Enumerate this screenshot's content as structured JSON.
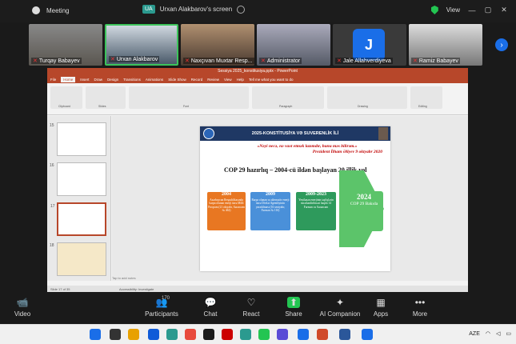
{
  "titlebar": {
    "app_name": "Meeting",
    "share_badge": "UA",
    "share_title": "Urxan Alakbarov's screen",
    "view_label": "View",
    "min_glyph": "—",
    "max_glyph": "▢",
    "close_glyph": "✕"
  },
  "gallery": {
    "participants": [
      {
        "name": "Turqay Babayev",
        "muted": true,
        "bg": "#6d6a63"
      },
      {
        "name": "Urxan Alakbarov",
        "muted": true,
        "bg": "#4a5a6a",
        "active": true
      },
      {
        "name": "Naxçıvan Muxtar Resp...",
        "muted": true,
        "bg": "#5c4a3e"
      },
      {
        "name": "Administrator",
        "muted": true,
        "bg": "#6c6f78"
      },
      {
        "name": "Jale Allahverdiyeva",
        "muted": true,
        "avatar": "J"
      },
      {
        "name": "Ramiz Babayev",
        "muted": true,
        "bg": "#7a7a78"
      }
    ],
    "mic_glyph": "⚡",
    "next_glyph": "›"
  },
  "powerpoint": {
    "window_title": "Sessiya 2025_konstitusiya.pptx - PowerPoint",
    "menu": [
      "File",
      "Home",
      "Insert",
      "Draw",
      "Design",
      "Transitions",
      "Animations",
      "Slide Show",
      "Record",
      "Review",
      "View",
      "Help",
      "Tell me what you want to do"
    ],
    "notes_hint": "Tap to add notes",
    "status_left": "Slide 17 of 35",
    "status_right": "Accessibility: Investigate",
    "thumb_numbers": [
      "15",
      "16",
      "17",
      "18"
    ],
    "ribbon_labels": [
      "Clipboard",
      "Slides",
      "Font",
      "Paragraph",
      "Drawing",
      "Editing"
    ]
  },
  "slide": {
    "header": "2025-KONSTİTUSİYA VƏ SUVERENLİK İLİ",
    "quote_line1": "«Nəyi necə, nə vaxt etmək lazımdır, bunu məs bilirəm.»",
    "quote_attr": "Prezident İlham Əliyev 9 oktyabr 2020",
    "heading": "COP 29 hazırlıq – 2004-cü ildən başlayan 20 illik yol",
    "boxes": [
      {
        "year": "2004",
        "text": "Azərbaycan Respublikasında bərpa olunan enerji üzrə Milli Proqram (21 oktyabr, Sərəncam № 462)",
        "color": "#e87722"
      },
      {
        "year": "2009",
        "text": "Bərpa olunan və alternativ enerji üzrə Dövlət Agentliyinin yaradılması (16 sentyabr, Fərman № 116)",
        "color": "#4a90d9"
      },
      {
        "year": "2009-2023",
        "text": "Yenilənən enerjinin təşfiqlərin sürətləndirilməsi haqda 14 Fərman və Sərəncam",
        "color": "#2e9a5c"
      },
      {
        "year": "2024",
        "text": "COP 29 Bakıda",
        "color": "#5cc46a"
      }
    ]
  },
  "toolbar": {
    "items": [
      {
        "label": "Video",
        "icon": "📹"
      },
      {
        "label": "Participants",
        "icon": "👥",
        "count": "170"
      },
      {
        "label": "Chat",
        "icon": "💬"
      },
      {
        "label": "React",
        "icon": "♡"
      },
      {
        "label": "Share",
        "icon": "⬆"
      },
      {
        "label": "AI Companion",
        "icon": "✦"
      },
      {
        "label": "Apps",
        "icon": "▦"
      },
      {
        "label": "More",
        "icon": "•••"
      }
    ]
  },
  "taskbar": {
    "lang": "AZE",
    "colors": [
      "#1a6ee8",
      "#333333",
      "#e8a100",
      "#0f5bd8",
      "#2b9a8f",
      "#e84a3c",
      "#1a1a1a",
      "#cc0000",
      "#2b9a8f",
      "#23c552",
      "#5a4bd6",
      "#1a6ee8",
      "#d04a2a",
      "#2b579a"
    ]
  }
}
